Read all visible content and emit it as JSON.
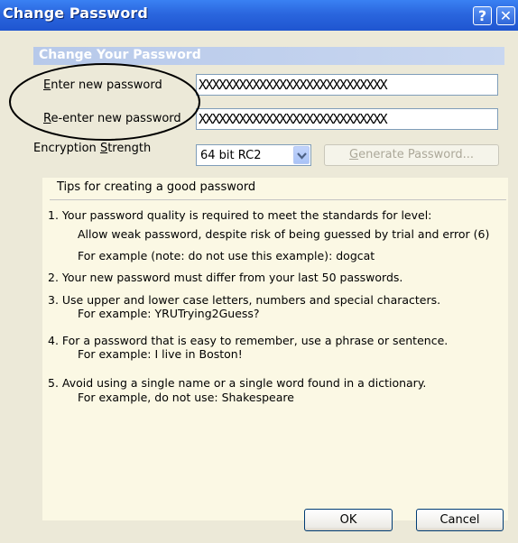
{
  "window": {
    "title": "Change Password",
    "help_glyph": "?",
    "close_glyph": "✕"
  },
  "group": {
    "header": "Change Your Password"
  },
  "fields": {
    "new_password": {
      "label_accel": "E",
      "label_rest": "nter new password",
      "value": "XXXXXXXXXXXXXXXXXXXXXXXXXXXX"
    },
    "reenter_password": {
      "label_accel": "R",
      "label_rest": "e-enter new password",
      "value": "XXXXXXXXXXXXXXXXXXXXXXXXXXXX"
    },
    "encryption": {
      "label_pre": "Encryption ",
      "label_accel": "S",
      "label_rest": "trength",
      "selected": "64 bit RC2"
    }
  },
  "buttons": {
    "generate_accel": "G",
    "generate_rest": "enerate Password...",
    "ok": "OK",
    "cancel": "Cancel"
  },
  "tips": {
    "heading": "Tips for creating a good password",
    "t1_line1": "1.  Your password quality is required to meet the standards for level:",
    "t1_line2": "Allow weak password, despite risk of being guessed by trial and error (6)",
    "t1_line3": "For example (note: do not use this example):  dogcat",
    "t2_line1": "2.  Your new password must differ from your last 50 passwords.",
    "t3_line1": "3.  Use upper and lower case letters, numbers and special characters.",
    "t3_line2": "For example:  YRUTrying2Guess?",
    "t4_line1": "4.  For a password that is easy to remember, use a phrase or sentence.",
    "t4_line2": "For example:  I live in Boston!",
    "t5_line1": "5.  Avoid using a single name or a single word found in a dictionary.",
    "t5_line2": "For example, do not use:  Shakespeare"
  },
  "colors": {
    "titlebar": "#2a66de",
    "dialog_bg": "#ece9d8",
    "tips_bg": "#fbf8e4"
  }
}
